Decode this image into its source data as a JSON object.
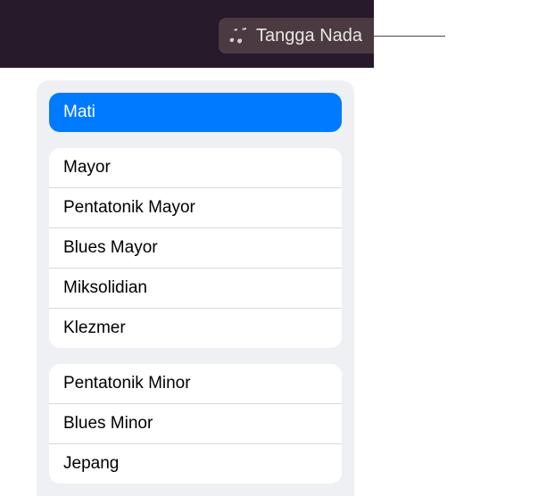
{
  "toolbar": {
    "scale_button_label": "Tangga Nada"
  },
  "popover": {
    "selected": {
      "label": "Mati"
    },
    "group1": [
      {
        "label": "Mayor"
      },
      {
        "label": "Pentatonik Mayor"
      },
      {
        "label": "Blues Mayor"
      },
      {
        "label": "Miksolidian"
      },
      {
        "label": "Klezmer"
      }
    ],
    "group2": [
      {
        "label": "Pentatonik Minor"
      },
      {
        "label": "Blues Minor"
      },
      {
        "label": "Jepang"
      }
    ]
  }
}
